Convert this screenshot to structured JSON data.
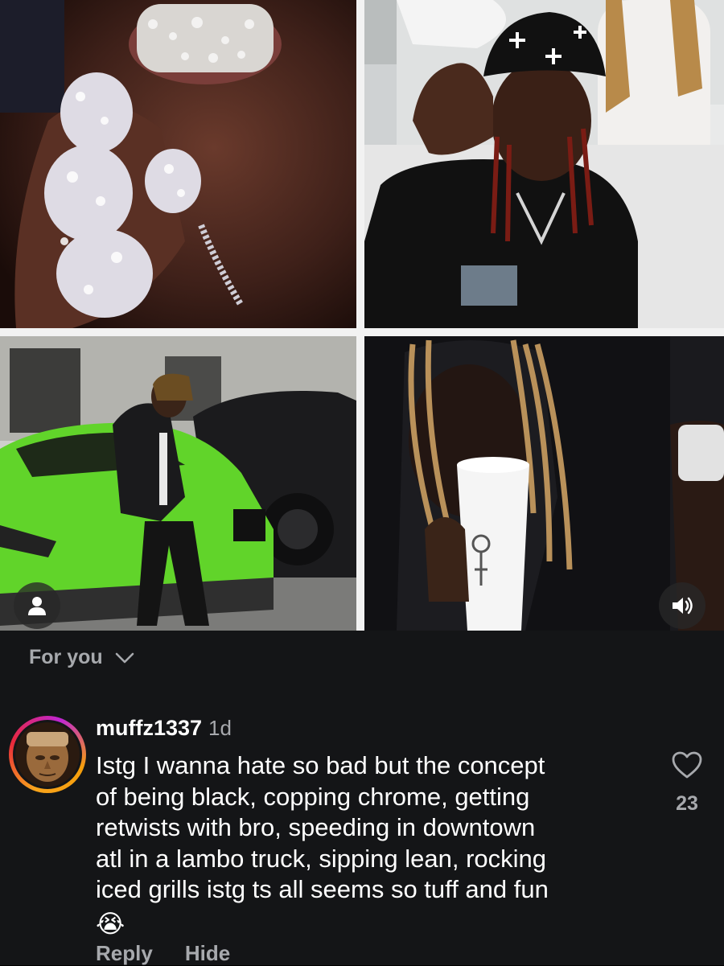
{
  "feed": {
    "label": "For you"
  },
  "media": {
    "tiles": [
      {
        "name": "photo-grills-and-rings"
      },
      {
        "name": "photo-beanie-pose"
      },
      {
        "name": "photo-green-lambo"
      },
      {
        "name": "photo-sipping-cup"
      }
    ]
  },
  "comment": {
    "username": "muffz1337",
    "time": "1d",
    "lines": [
      "Istg I wanna hate so bad but the concept",
      "of being black, copping chrome, getting",
      "retwists with bro, speeding in downtown",
      "atl in a lambo truck, sipping lean, rocking",
      "iced grills istg ts all seems so tuff and fun"
    ],
    "emoji": "😭",
    "like_count": "23",
    "reply_label": "Reply",
    "hide_label": "Hide"
  },
  "icons": {
    "profile": "person-icon",
    "sound": "speaker-icon",
    "dropdown": "chevron-down-icon",
    "like": "heart-icon"
  },
  "colors": {
    "panel_bg": "#141517",
    "muted_text": "#a7a9ad",
    "primary_text": "#ffffff",
    "car_green": "#61d42a"
  }
}
